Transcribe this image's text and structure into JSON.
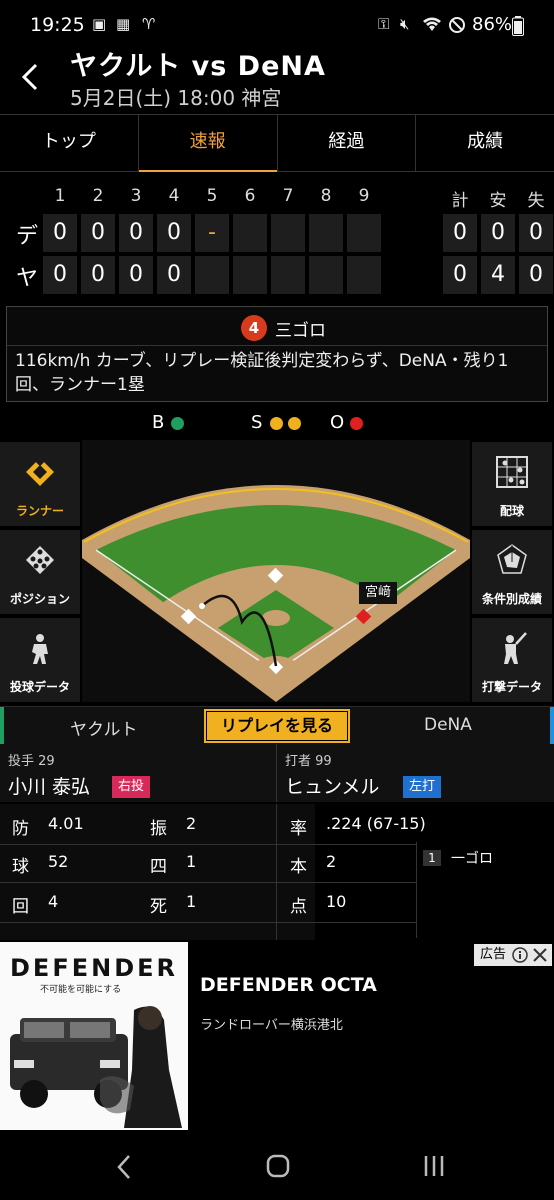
{
  "status_bar": {
    "time": "19:25",
    "battery": "86%",
    "left_icons": [
      "image-icon",
      "qr-icon",
      "flashlight-icon"
    ],
    "right_icons": [
      "vpn-icon",
      "mute-icon",
      "wifi-icon",
      "dnd-icon",
      "battery-icon"
    ]
  },
  "header": {
    "title": "ヤクルト vs DeNA",
    "subtitle": "5月2日(土) 18:00 神宮"
  },
  "tabs": [
    {
      "label": "トップ",
      "active": false
    },
    {
      "label": "速報",
      "active": true
    },
    {
      "label": "経過",
      "active": false
    },
    {
      "label": "成績",
      "active": false
    }
  ],
  "scoreboard": {
    "innings": [
      "1",
      "2",
      "3",
      "4",
      "5",
      "6",
      "7",
      "8",
      "9"
    ],
    "totals_headers": [
      "計",
      "安",
      "失"
    ],
    "teams": [
      {
        "abbr": "デ",
        "innings": [
          "0",
          "0",
          "0",
          "0",
          "-",
          "",
          "",
          "",
          ""
        ],
        "totals": [
          "0",
          "0",
          "0"
        ]
      },
      {
        "abbr": "ヤ",
        "innings": [
          "0",
          "0",
          "0",
          "0",
          "",
          "",
          "",
          "",
          ""
        ],
        "totals": [
          "0",
          "4",
          "0"
        ]
      }
    ]
  },
  "play": {
    "number": "4",
    "result": "三ゴロ",
    "description": "116km/h カーブ、リプレー検証後判定変わらず、DeNA・残り1回、ランナー1塁"
  },
  "count": {
    "b_label": "B",
    "b": 1,
    "s_label": "S",
    "s": 2,
    "o_label": "O",
    "o": 1,
    "colors": {
      "ball": "#20a060",
      "strike": "#f0b020",
      "out": "#e02020"
    }
  },
  "left_menu": [
    {
      "label": "ランナー",
      "icon": "diamond-icon",
      "active": true
    },
    {
      "label": "ポジション",
      "icon": "positions-icon",
      "active": false
    },
    {
      "label": "投球データ",
      "icon": "pitcher-icon",
      "active": false
    }
  ],
  "right_menu": [
    {
      "label": "配球",
      "icon": "grid-icon"
    },
    {
      "label": "条件別成績",
      "icon": "radar-icon"
    },
    {
      "label": "打撃データ",
      "icon": "batter-icon"
    }
  ],
  "field": {
    "runner_label": "宮﨑"
  },
  "replay_bar": {
    "home": "ヤクルト",
    "button": "リプレイを見る",
    "away": "DeNA"
  },
  "pitcher": {
    "role": "投手 29",
    "name": "小川 泰弘",
    "hand": "右投",
    "stats": [
      {
        "k": "防",
        "v": "4.01",
        "k2": "振",
        "v2": "2"
      },
      {
        "k": "球",
        "v": "52",
        "k2": "四",
        "v2": "1"
      },
      {
        "k": "回",
        "v": "4",
        "k2": "死",
        "v2": "1"
      }
    ]
  },
  "batter": {
    "role": "打者 99",
    "name": "ヒュンメル",
    "hand": "左打",
    "stats": [
      {
        "k": "率",
        "v": ".224 (67-15)"
      },
      {
        "k": "本",
        "v": "2"
      },
      {
        "k": "点",
        "v": "10"
      }
    ]
  },
  "pitch_log": [
    {
      "n": "1",
      "label": "一ゴロ"
    }
  ],
  "ad": {
    "brand": "DEFENDER",
    "tagline": "不可能を可能にする",
    "title": "DEFENDER OCTA",
    "sub": "ランドローバー横浜港北",
    "tag": "広告"
  }
}
